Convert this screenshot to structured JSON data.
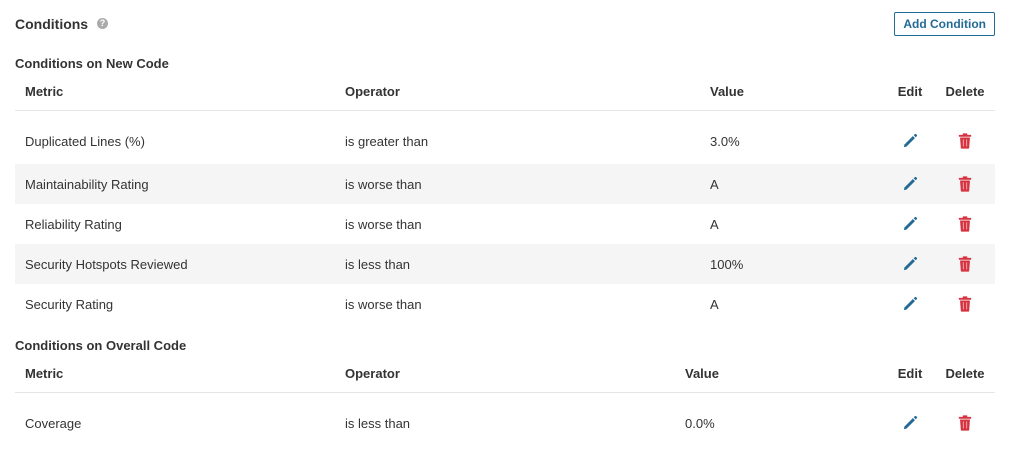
{
  "header": {
    "title": "Conditions",
    "help_glyph": "?",
    "add_button_label": "Add Condition"
  },
  "icons": {
    "edit": "pencil-icon",
    "delete": "trash-icon",
    "help": "question-circle-icon"
  },
  "colors": {
    "accent": "#236a97",
    "danger": "#d4333f",
    "row_alt": "#f5f5f5"
  },
  "new_code": {
    "title": "Conditions on New Code",
    "columns": {
      "metric": "Metric",
      "operator": "Operator",
      "value": "Value",
      "edit": "Edit",
      "delete": "Delete"
    },
    "rows": [
      {
        "metric": "Duplicated Lines (%)",
        "operator": "is greater than",
        "value": "3.0%"
      },
      {
        "metric": "Maintainability Rating",
        "operator": "is worse than",
        "value": "A"
      },
      {
        "metric": "Reliability Rating",
        "operator": "is worse than",
        "value": "A"
      },
      {
        "metric": "Security Hotspots Reviewed",
        "operator": "is less than",
        "value": "100%"
      },
      {
        "metric": "Security Rating",
        "operator": "is worse than",
        "value": "A"
      }
    ]
  },
  "overall_code": {
    "title": "Conditions on Overall Code",
    "columns": {
      "metric": "Metric",
      "operator": "Operator",
      "value": "Value",
      "edit": "Edit",
      "delete": "Delete"
    },
    "rows": [
      {
        "metric": "Coverage",
        "operator": "is less than",
        "value": "0.0%"
      }
    ]
  }
}
